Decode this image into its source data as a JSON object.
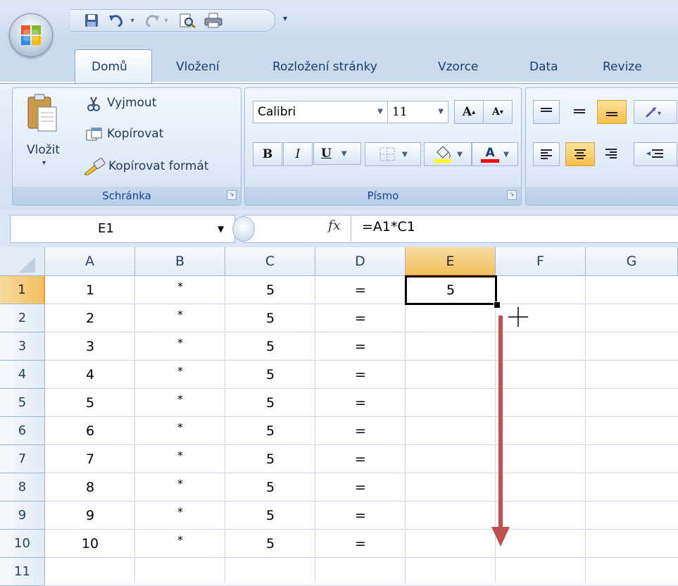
{
  "quick_access": {
    "items": [
      "save-icon",
      "undo-icon",
      "redo-icon",
      "print-preview-icon",
      "print-icon",
      "customize-dropdown-icon"
    ]
  },
  "tabs": [
    {
      "label": "Domů",
      "active": true
    },
    {
      "label": "Vložení"
    },
    {
      "label": "Rozložení stránky"
    },
    {
      "label": "Vzorce"
    },
    {
      "label": "Data"
    },
    {
      "label": "Revize"
    }
  ],
  "clipboard": {
    "paste_label": "Vložit",
    "cut_label": "Vyjmout",
    "copy_label": "Kopírovat",
    "format_painter_label": "Kopírovat formát",
    "group_label": "Schránka"
  },
  "font": {
    "font_name": "Calibri",
    "font_size": "11",
    "bold": "B",
    "italic": "I",
    "underline": "U",
    "group_label": "Písmo",
    "grow_label": "A",
    "shrink_label": "A",
    "font_color_label": "A"
  },
  "colors": {
    "highlight_fill": "#ffff00",
    "font_color": "#ff0000",
    "selected_header": "#f1c15f",
    "arrow": "#c0504d"
  },
  "formula_bar": {
    "name_box": "E1",
    "fx": "fx",
    "formula": "=A1*C1"
  },
  "sheet": {
    "columns": [
      "A",
      "B",
      "C",
      "D",
      "E",
      "F",
      "G"
    ],
    "rows": [
      "1",
      "2",
      "3",
      "4",
      "5",
      "6",
      "7",
      "8",
      "9",
      "10",
      "11"
    ],
    "cells": [
      [
        "1",
        "*",
        "5",
        "=",
        "5"
      ],
      [
        "2",
        "*",
        "5",
        "="
      ],
      [
        "3",
        "*",
        "5",
        "="
      ],
      [
        "4",
        "*",
        "5",
        "="
      ],
      [
        "5",
        "*",
        "5",
        "="
      ],
      [
        "6",
        "*",
        "5",
        "="
      ],
      [
        "7",
        "*",
        "5",
        "="
      ],
      [
        "8",
        "*",
        "5",
        "="
      ],
      [
        "9",
        "*",
        "5",
        "="
      ],
      [
        "10",
        "*",
        "5",
        "="
      ]
    ]
  }
}
